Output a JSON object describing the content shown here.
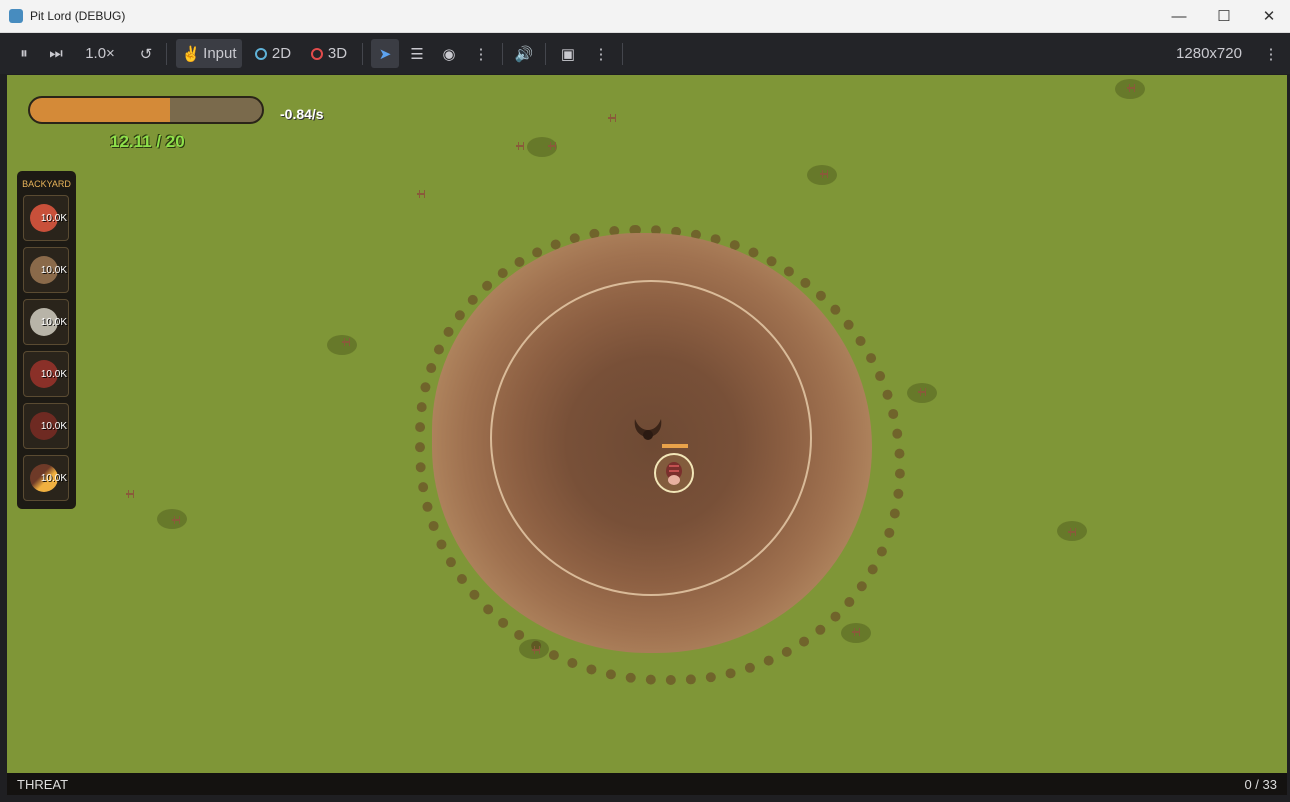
{
  "window": {
    "title": "Pit Lord (DEBUG)"
  },
  "toolbar": {
    "speed": "1.0×",
    "input_label": "Input",
    "mode_2d": "2D",
    "mode_3d": "3D",
    "resolution": "1280x720"
  },
  "hud": {
    "resource_rate": "-0.84/s",
    "resource_amount": "12.11 / 20",
    "resource_fill": 0.605
  },
  "inventory": {
    "title": "BACKYARD",
    "items": [
      {
        "icon": "meat-icon",
        "quantity": "10.0K"
      },
      {
        "icon": "horns-icon",
        "quantity": "10.0K"
      },
      {
        "icon": "stone-icon",
        "quantity": "10.0K"
      },
      {
        "icon": "flesh-icon",
        "quantity": "10.0K"
      },
      {
        "icon": "leg-icon",
        "quantity": "10.0K"
      },
      {
        "icon": "torch-icon",
        "quantity": "10.0K"
      }
    ]
  },
  "status": {
    "label": "THREAT",
    "count": "0 / 33"
  },
  "colors": {
    "grass": "#7f9637",
    "pit": "#8c5f42",
    "resource_fill": "#d48a38",
    "amount_text": "#8ee04a",
    "inventory_title": "#e8b45a"
  }
}
